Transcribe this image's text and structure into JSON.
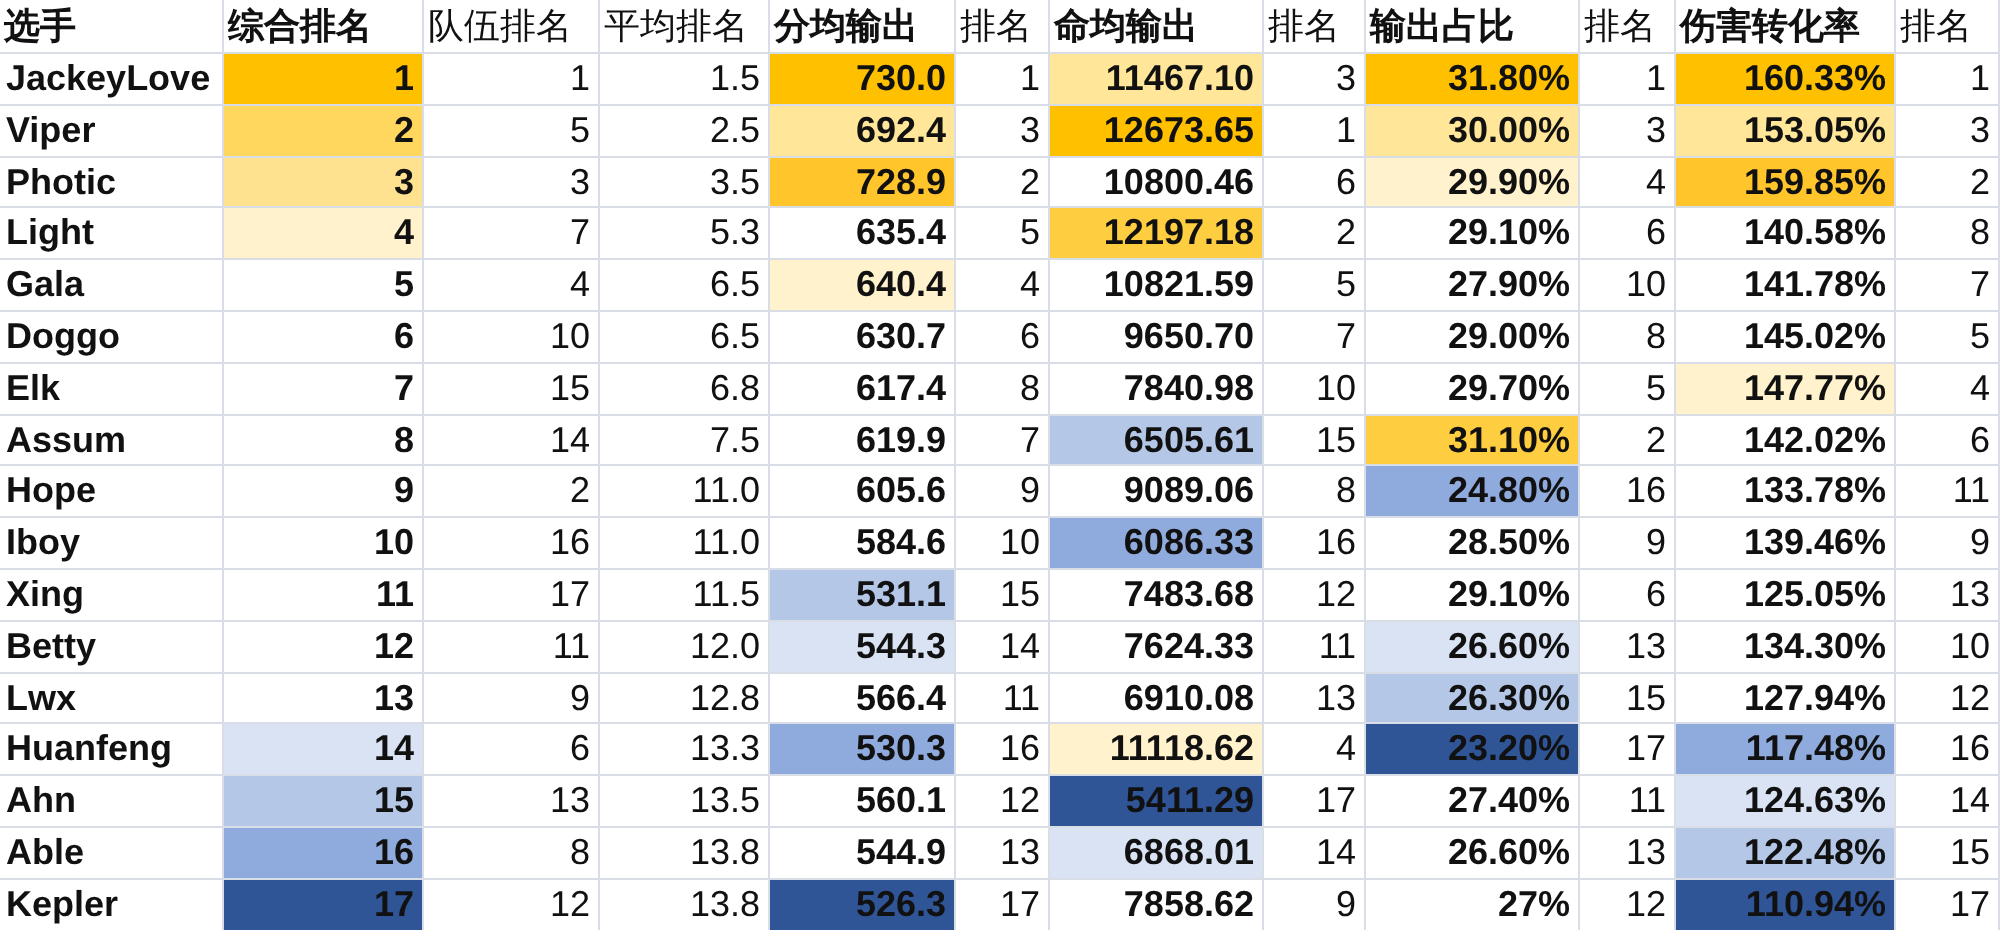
{
  "columns": [
    {
      "label": "选手",
      "bold": true
    },
    {
      "label": "综合排名",
      "bold": true
    },
    {
      "label": "队伍排名",
      "bold": false
    },
    {
      "label": "平均排名",
      "bold": false
    },
    {
      "label": "分均输出",
      "bold": true
    },
    {
      "label": "排名",
      "bold": false
    },
    {
      "label": "命均输出",
      "bold": true
    },
    {
      "label": "排名",
      "bold": false
    },
    {
      "label": "输出占比",
      "bold": true
    },
    {
      "label": "排名",
      "bold": false
    },
    {
      "label": "伤害转化率",
      "bold": true
    },
    {
      "label": "排名",
      "bold": false
    }
  ],
  "rows": [
    {
      "cells": [
        {
          "text": "JackeyLove"
        },
        {
          "text": "1",
          "color": "#ffc000"
        },
        {
          "text": "1"
        },
        {
          "text": "1.5"
        },
        {
          "text": "730.0",
          "color": "#ffc000"
        },
        {
          "text": "1"
        },
        {
          "text": "11467.10",
          "color": "#ffe699"
        },
        {
          "text": "3"
        },
        {
          "text": "31.80%",
          "color": "#ffc000"
        },
        {
          "text": "1"
        },
        {
          "text": "160.33%",
          "color": "#ffc000"
        },
        {
          "text": "1"
        }
      ]
    },
    {
      "cells": [
        {
          "text": "Viper"
        },
        {
          "text": "2",
          "color": "#ffd75e"
        },
        {
          "text": "5"
        },
        {
          "text": "2.5"
        },
        {
          "text": "692.4",
          "color": "#ffe699"
        },
        {
          "text": "3"
        },
        {
          "text": "12673.65",
          "color": "#ffc000"
        },
        {
          "text": "1"
        },
        {
          "text": "30.00%",
          "color": "#ffe699"
        },
        {
          "text": "3"
        },
        {
          "text": "153.05%",
          "color": "#ffe699"
        },
        {
          "text": "3"
        }
      ]
    },
    {
      "cells": [
        {
          "text": "Photic"
        },
        {
          "text": "3",
          "color": "#ffe28f"
        },
        {
          "text": "3"
        },
        {
          "text": "3.5"
        },
        {
          "text": "728.9",
          "color": "#ffc52a"
        },
        {
          "text": "2"
        },
        {
          "text": "10800.46"
        },
        {
          "text": "6"
        },
        {
          "text": "29.90%",
          "color": "#fff2cc"
        },
        {
          "text": "4"
        },
        {
          "text": "159.85%",
          "color": "#ffc52a"
        },
        {
          "text": "2"
        }
      ]
    },
    {
      "cells": [
        {
          "text": "Light"
        },
        {
          "text": "4",
          "color": "#fff2cc"
        },
        {
          "text": "7"
        },
        {
          "text": "5.3"
        },
        {
          "text": "635.4"
        },
        {
          "text": "5"
        },
        {
          "text": "12197.18",
          "color": "#ffcd40"
        },
        {
          "text": "2"
        },
        {
          "text": "29.10%"
        },
        {
          "text": "6"
        },
        {
          "text": "140.58%"
        },
        {
          "text": "8"
        }
      ]
    },
    {
      "cells": [
        {
          "text": "Gala"
        },
        {
          "text": "5"
        },
        {
          "text": "4"
        },
        {
          "text": "6.5"
        },
        {
          "text": "640.4",
          "color": "#fff2cc"
        },
        {
          "text": "4"
        },
        {
          "text": "10821.59"
        },
        {
          "text": "5"
        },
        {
          "text": "27.90%"
        },
        {
          "text": "10"
        },
        {
          "text": "141.78%"
        },
        {
          "text": "7"
        }
      ]
    },
    {
      "cells": [
        {
          "text": "Doggo"
        },
        {
          "text": "6"
        },
        {
          "text": "10"
        },
        {
          "text": "6.5"
        },
        {
          "text": "630.7"
        },
        {
          "text": "6"
        },
        {
          "text": "9650.70"
        },
        {
          "text": "7"
        },
        {
          "text": "29.00%"
        },
        {
          "text": "8"
        },
        {
          "text": "145.02%"
        },
        {
          "text": "5"
        }
      ]
    },
    {
      "cells": [
        {
          "text": "Elk"
        },
        {
          "text": "7"
        },
        {
          "text": "15"
        },
        {
          "text": "6.8"
        },
        {
          "text": "617.4"
        },
        {
          "text": "8"
        },
        {
          "text": "7840.98"
        },
        {
          "text": "10"
        },
        {
          "text": "29.70%"
        },
        {
          "text": "5"
        },
        {
          "text": "147.77%",
          "color": "#fff2cc"
        },
        {
          "text": "4"
        }
      ]
    },
    {
      "cells": [
        {
          "text": "Assum"
        },
        {
          "text": "8"
        },
        {
          "text": "14"
        },
        {
          "text": "7.5"
        },
        {
          "text": "619.9"
        },
        {
          "text": "7"
        },
        {
          "text": "6505.61",
          "color": "#b4c7e7"
        },
        {
          "text": "15"
        },
        {
          "text": "31.10%",
          "color": "#ffcd40"
        },
        {
          "text": "2"
        },
        {
          "text": "142.02%"
        },
        {
          "text": "6"
        }
      ]
    },
    {
      "cells": [
        {
          "text": "Hope"
        },
        {
          "text": "9"
        },
        {
          "text": "2"
        },
        {
          "text": "11.0"
        },
        {
          "text": "605.6"
        },
        {
          "text": "9"
        },
        {
          "text": "9089.06"
        },
        {
          "text": "8"
        },
        {
          "text": "24.80%",
          "color": "#8faadc"
        },
        {
          "text": "16"
        },
        {
          "text": "133.78%"
        },
        {
          "text": "11"
        }
      ]
    },
    {
      "cells": [
        {
          "text": "Iboy"
        },
        {
          "text": "10"
        },
        {
          "text": "16"
        },
        {
          "text": "11.0"
        },
        {
          "text": "584.6"
        },
        {
          "text": "10"
        },
        {
          "text": "6086.33",
          "color": "#8faadc"
        },
        {
          "text": "16"
        },
        {
          "text": "28.50%"
        },
        {
          "text": "9"
        },
        {
          "text": "139.46%"
        },
        {
          "text": "9"
        }
      ]
    },
    {
      "cells": [
        {
          "text": "Xing"
        },
        {
          "text": "11"
        },
        {
          "text": "17"
        },
        {
          "text": "11.5"
        },
        {
          "text": "531.1",
          "color": "#b4c7e7"
        },
        {
          "text": "15"
        },
        {
          "text": "7483.68"
        },
        {
          "text": "12"
        },
        {
          "text": "29.10%"
        },
        {
          "text": "6"
        },
        {
          "text": "125.05%"
        },
        {
          "text": "13"
        }
      ]
    },
    {
      "cells": [
        {
          "text": "Betty"
        },
        {
          "text": "12"
        },
        {
          "text": "11"
        },
        {
          "text": "12.0"
        },
        {
          "text": "544.3",
          "color": "#dae3f3"
        },
        {
          "text": "14"
        },
        {
          "text": "7624.33"
        },
        {
          "text": "11"
        },
        {
          "text": "26.60%",
          "color": "#dae3f3"
        },
        {
          "text": "13"
        },
        {
          "text": "134.30%"
        },
        {
          "text": "10"
        }
      ]
    },
    {
      "cells": [
        {
          "text": "Lwx"
        },
        {
          "text": "13"
        },
        {
          "text": "9"
        },
        {
          "text": "12.8"
        },
        {
          "text": "566.4"
        },
        {
          "text": "11"
        },
        {
          "text": "6910.08"
        },
        {
          "text": "13"
        },
        {
          "text": "26.30%",
          "color": "#b4c7e7"
        },
        {
          "text": "15"
        },
        {
          "text": "127.94%"
        },
        {
          "text": "12"
        }
      ]
    },
    {
      "cells": [
        {
          "text": "Huanfeng"
        },
        {
          "text": "14",
          "color": "#dae3f3"
        },
        {
          "text": "6"
        },
        {
          "text": "13.3"
        },
        {
          "text": "530.3",
          "color": "#8faadc"
        },
        {
          "text": "16"
        },
        {
          "text": "11118.62",
          "color": "#fff2cc"
        },
        {
          "text": "4"
        },
        {
          "text": "23.20%",
          "color": "#2f5597"
        },
        {
          "text": "17"
        },
        {
          "text": "117.48%",
          "color": "#8faadc"
        },
        {
          "text": "16"
        }
      ]
    },
    {
      "cells": [
        {
          "text": "Ahn"
        },
        {
          "text": "15",
          "color": "#b4c7e7"
        },
        {
          "text": "13"
        },
        {
          "text": "13.5"
        },
        {
          "text": "560.1"
        },
        {
          "text": "12"
        },
        {
          "text": "5411.29",
          "color": "#2f5597"
        },
        {
          "text": "17"
        },
        {
          "text": "27.40%"
        },
        {
          "text": "11"
        },
        {
          "text": "124.63%",
          "color": "#dae3f3"
        },
        {
          "text": "14"
        }
      ]
    },
    {
      "cells": [
        {
          "text": "Able"
        },
        {
          "text": "16",
          "color": "#8faadc"
        },
        {
          "text": "8"
        },
        {
          "text": "13.8"
        },
        {
          "text": "544.9"
        },
        {
          "text": "13"
        },
        {
          "text": "6868.01",
          "color": "#dae3f3"
        },
        {
          "text": "14"
        },
        {
          "text": "26.60%"
        },
        {
          "text": "13"
        },
        {
          "text": "122.48%",
          "color": "#b4c7e7"
        },
        {
          "text": "15"
        }
      ]
    },
    {
      "cells": [
        {
          "text": "Kepler"
        },
        {
          "text": "17",
          "color": "#2f5597"
        },
        {
          "text": "12"
        },
        {
          "text": "13.8"
        },
        {
          "text": "526.3",
          "color": "#2f5597"
        },
        {
          "text": "17"
        },
        {
          "text": "7858.62"
        },
        {
          "text": "9"
        },
        {
          "text": "27%"
        },
        {
          "text": "12"
        },
        {
          "text": "110.94%",
          "color": "#2f5597"
        },
        {
          "text": "17"
        }
      ]
    }
  ]
}
